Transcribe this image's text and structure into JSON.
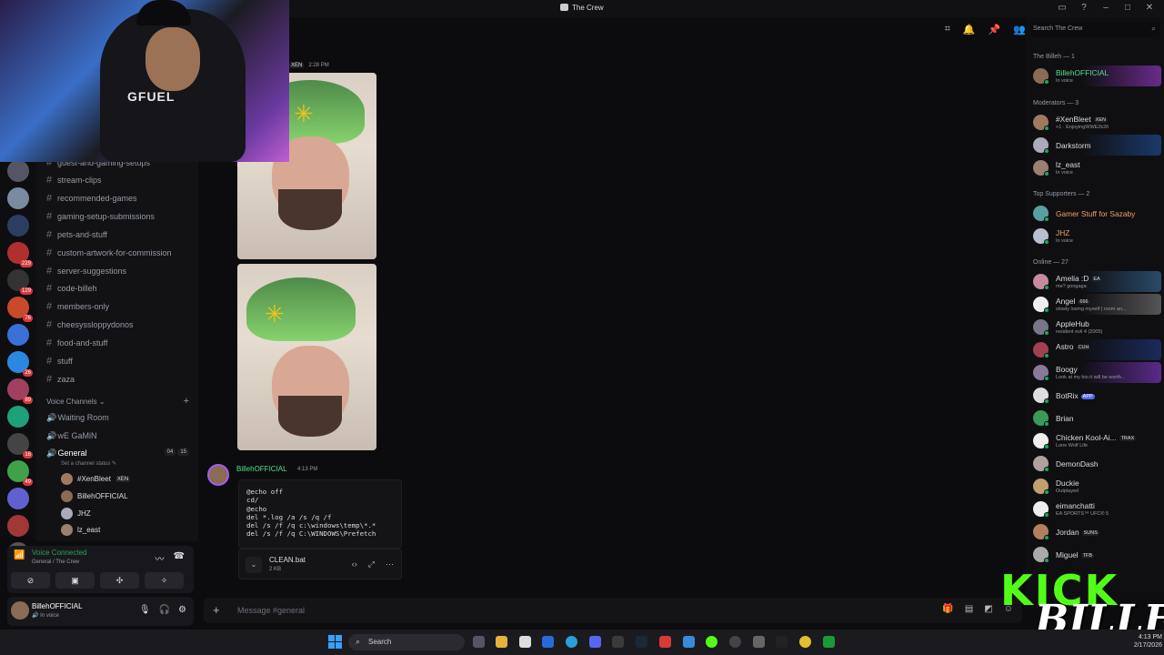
{
  "window": {
    "title": "The Crew"
  },
  "titlebar_icons": [
    "inbox-icon",
    "help-icon",
    "minimize-icon",
    "maximize-icon",
    "close-icon"
  ],
  "channels": {
    "partial_top": "guest-and-gaming-setups",
    "text": [
      "stream-clips",
      "recommended-games",
      "gaming-setup-submissions",
      "pets-and-stuff",
      "custom-artwork-for-commission",
      "server-suggestions",
      "code-billeh",
      "members-only",
      "cheesyssloppydonos",
      "food-and-stuff",
      "stuff",
      "zaza"
    ],
    "voice_header": "Voice Channels",
    "voice": [
      "Waiting Room",
      "wE GaMiN",
      "General"
    ],
    "general_status": "Set a channel status",
    "general_counts": [
      "04",
      "15"
    ],
    "voice_users": [
      {
        "name": "#XenBleet",
        "tag": "XEN"
      },
      {
        "name": "BillehOFFICIAL",
        "tag": ""
      },
      {
        "name": "JHZ",
        "tag": ""
      },
      {
        "name": "lz_east",
        "tag": ""
      }
    ]
  },
  "server_badges": [
    "229",
    "129",
    "76",
    "26",
    "89",
    "16",
    "49"
  ],
  "voice_bar": {
    "title": "Voice Connected",
    "subtitle": "General / The Crew"
  },
  "user": {
    "name": "BillehOFFICIAL",
    "status": "In voice"
  },
  "messages": {
    "first_author_tag": "XEN",
    "first_time": "2:28 PM",
    "second_author": "BillehOFFICIAL",
    "second_time": "4:13 PM",
    "code_lines": [
      "@echo off",
      "cd/",
      "@echo",
      "del *.log /a /s /q /f",
      "del /s /f /q c:\\windows\\temp\\*.*",
      "del /s /f /q C:\\WINDOWS\\Prefetch"
    ],
    "file": {
      "name": "CLEAN.bat",
      "size": "2 KB"
    }
  },
  "composer": {
    "placeholder": "Message #general"
  },
  "members": {
    "search_placeholder": "Search The Crew",
    "groups": [
      {
        "label": "The Billeh — 1"
      },
      {
        "label": "Moderators — 3"
      },
      {
        "label": "Top Supporters — 2"
      },
      {
        "label": "Online — 27"
      }
    ],
    "list": [
      {
        "name": "BillehOFFICIAL",
        "tag": "",
        "sub": "In voice",
        "color": "#55e08b"
      },
      {
        "name": "#XenBleet",
        "tag": "XEN",
        "sub": "+1 · EnjoyingWWE2k26",
        "color": "#dbdee1"
      },
      {
        "name": "Darkstorm",
        "tag": "",
        "sub": "",
        "color": "#dbdee1"
      },
      {
        "name": "lz_east",
        "tag": "",
        "sub": "In voice",
        "color": "#dbdee1"
      },
      {
        "name": "Gamer Stuff for Sazaby",
        "tag": "",
        "sub": "",
        "color": "#f0a35e"
      },
      {
        "name": "JHZ",
        "tag": "",
        "sub": "In voice",
        "color": "#f0a35e"
      },
      {
        "name": "Amelia :D",
        "tag": "EA",
        "sub": "me? gongaga",
        "color": "#dbdee1"
      },
      {
        "name": "Angel",
        "tag": "666",
        "sub": "slowly losing myself | room an...",
        "color": "#dbdee1"
      },
      {
        "name": "AppleHub",
        "tag": "",
        "sub": "resident evil 4 (2005)",
        "color": "#dbdee1"
      },
      {
        "name": "Astro",
        "tag": "CUH",
        "sub": "",
        "color": "#dbdee1"
      },
      {
        "name": "Boogy",
        "tag": "",
        "sub": "Look at my bio it will be worth...",
        "color": "#dbdee1"
      },
      {
        "name": "BotRix",
        "tag": "APP",
        "sub": "",
        "color": "#dbdee1"
      },
      {
        "name": "Brian",
        "tag": "",
        "sub": "",
        "color": "#dbdee1"
      },
      {
        "name": "Chicken Kool-Ai...",
        "tag": "TRAX",
        "sub": "Lone Wolf Life",
        "color": "#dbdee1"
      },
      {
        "name": "DemonDash",
        "tag": "",
        "sub": "",
        "color": "#dbdee1"
      },
      {
        "name": "Duckie",
        "tag": "",
        "sub": "Outplayed",
        "color": "#dbdee1"
      },
      {
        "name": "eimanchatti",
        "tag": "",
        "sub": "EA SPORTS™ UFC® 5",
        "color": "#dbdee1"
      },
      {
        "name": "Jordan",
        "tag": "SUNS",
        "sub": "",
        "color": "#dbdee1"
      },
      {
        "name": "Miguel",
        "tag": "TFB",
        "sub": "",
        "color": "#dbdee1"
      }
    ]
  },
  "overlay": {
    "brand_top": "KICK",
    "brand_bottom": "BILLEH",
    "webcam_logo": "GFUEL"
  },
  "taskbar": {
    "search": "Search",
    "time": "4:13 PM",
    "date": "2/17/2026"
  }
}
